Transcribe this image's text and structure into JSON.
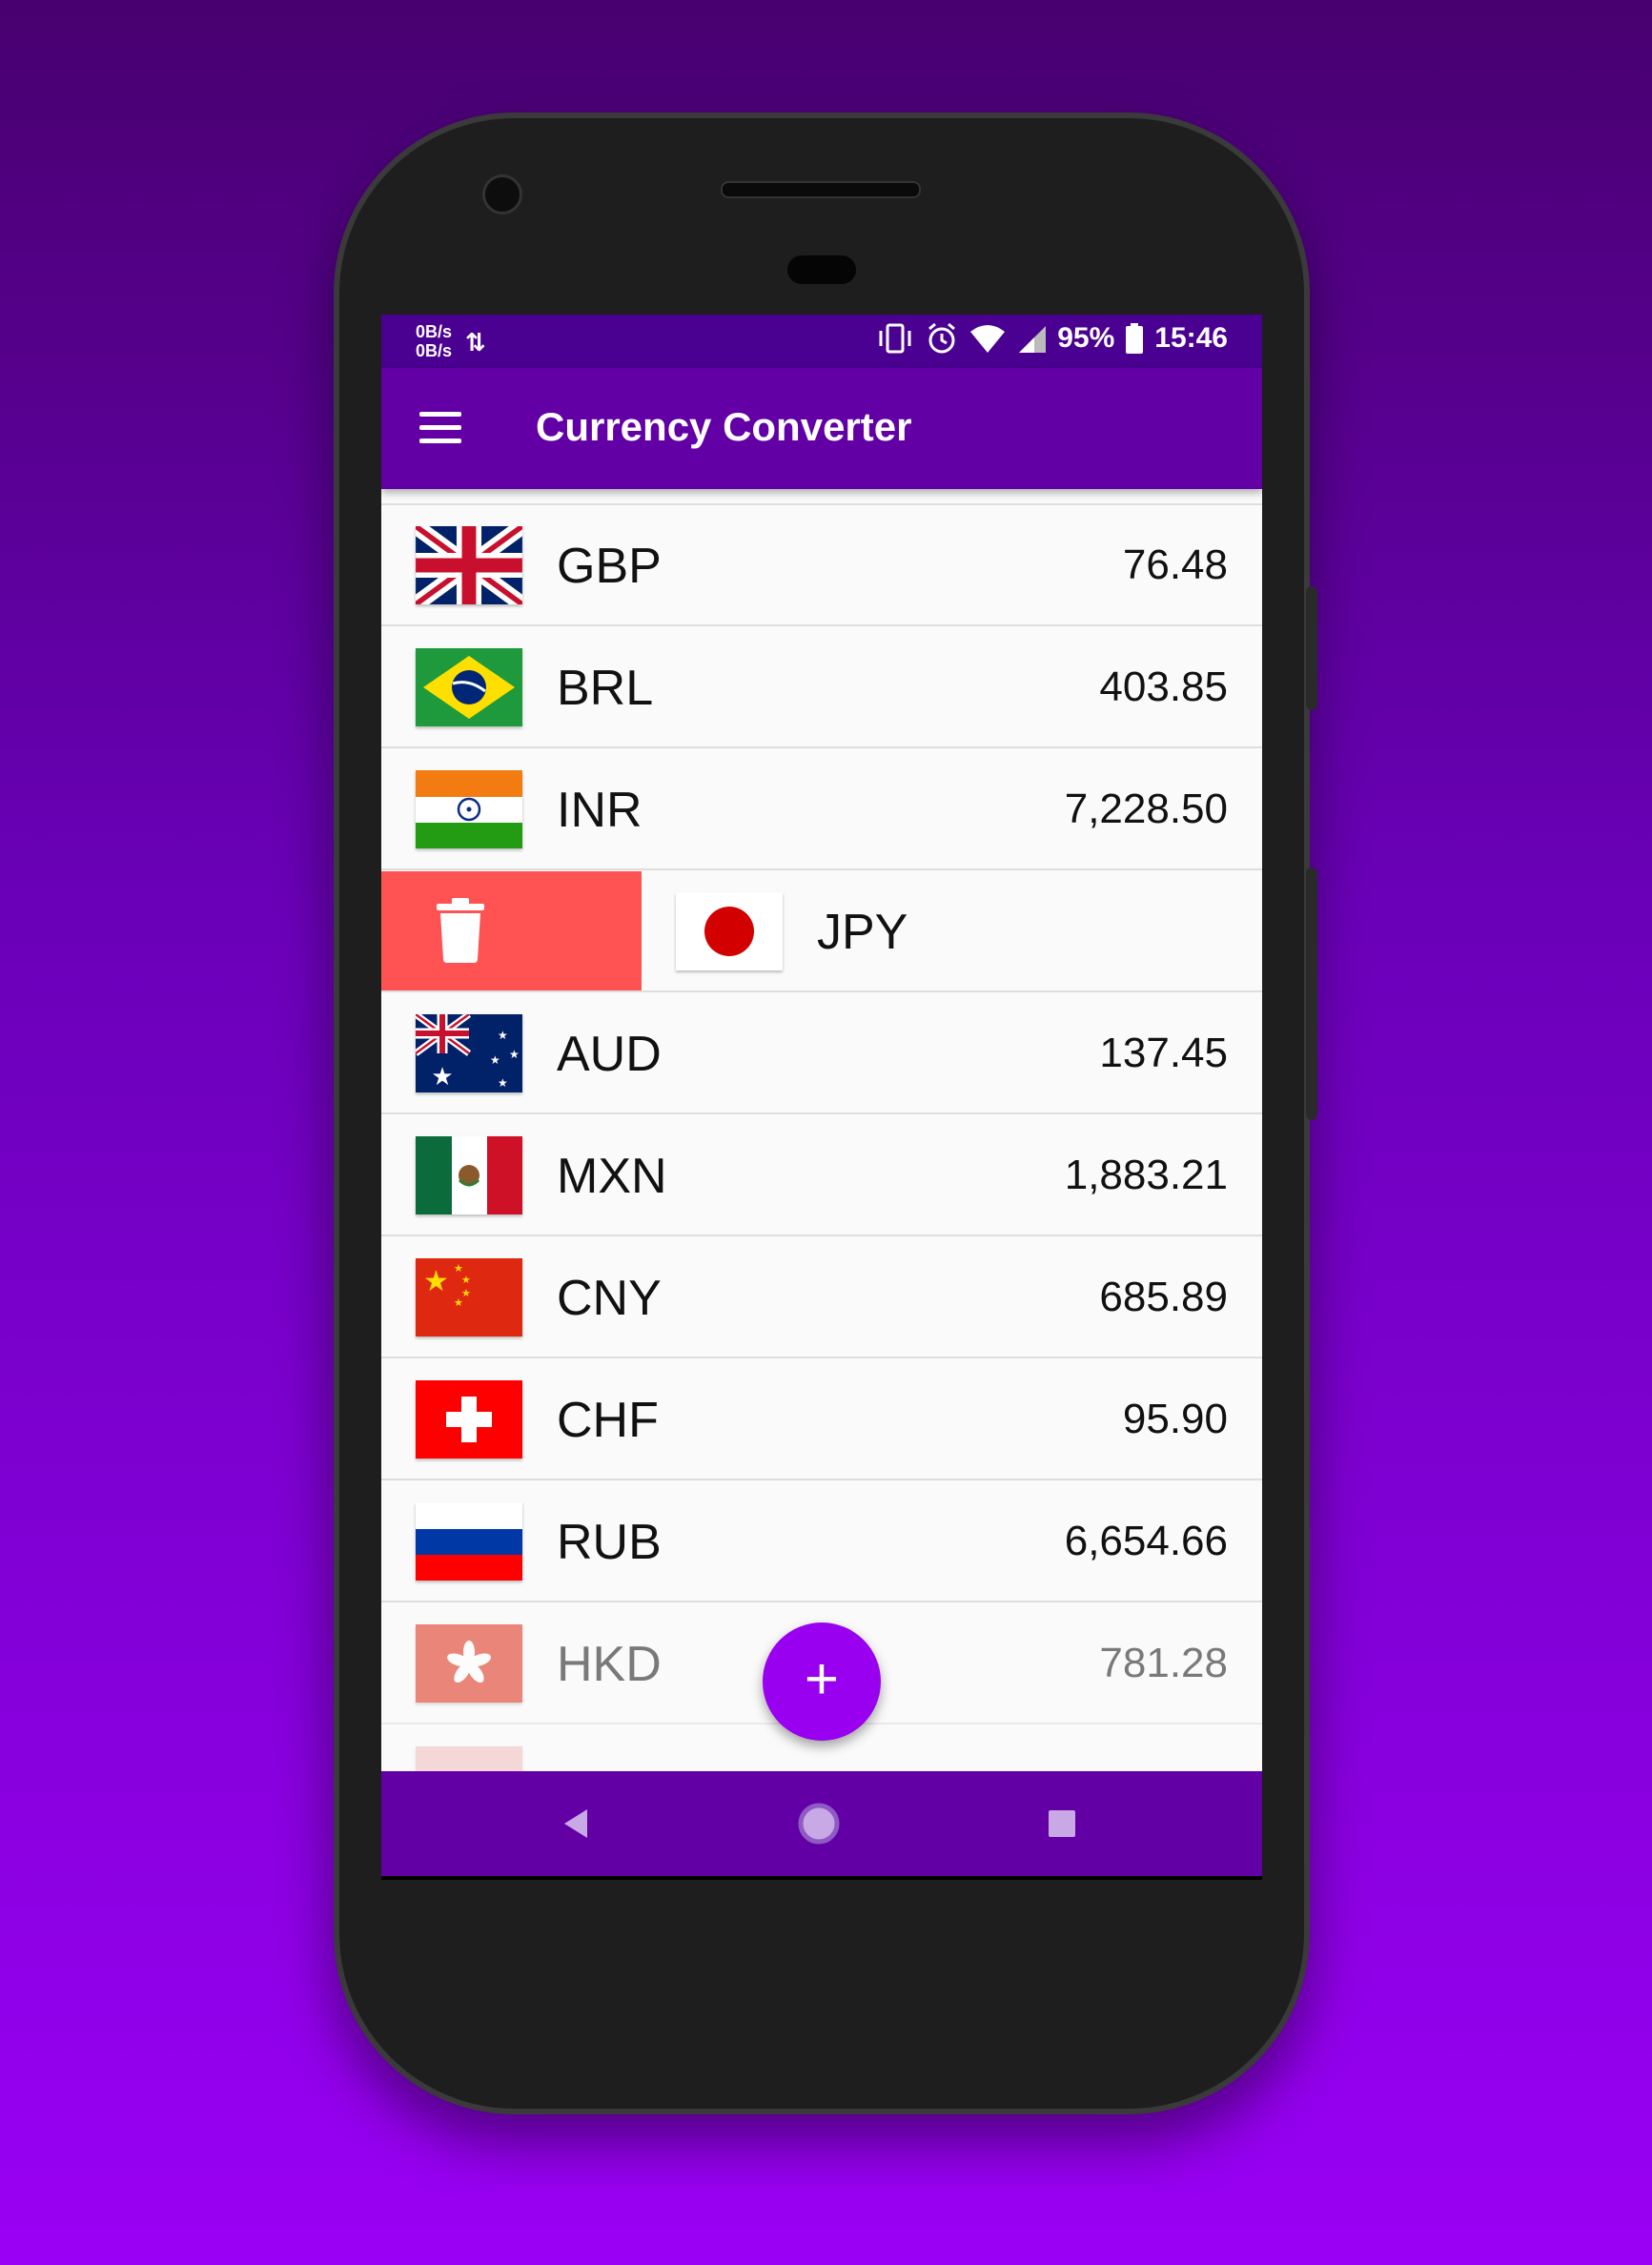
{
  "status_bar": {
    "net_up": "0B/s",
    "net_down": "0B/s",
    "battery": "95%",
    "time": "15:46"
  },
  "app_bar": {
    "title": "Currency Converter"
  },
  "currencies": [
    {
      "code": "GBP",
      "value": "76.48",
      "flag": "uk-flag"
    },
    {
      "code": "BRL",
      "value": "403.85",
      "flag": "brazil-flag"
    },
    {
      "code": "INR",
      "value": "7,228.50",
      "flag": "india-flag"
    },
    {
      "code": "JPY",
      "value": "",
      "flag": "japan-flag",
      "swiped": true
    },
    {
      "code": "AUD",
      "value": "137.45",
      "flag": "australia-flag"
    },
    {
      "code": "MXN",
      "value": "1,883.21",
      "flag": "mexico-flag"
    },
    {
      "code": "CNY",
      "value": "685.89",
      "flag": "china-flag"
    },
    {
      "code": "CHF",
      "value": "95.90",
      "flag": "switzerland-flag"
    },
    {
      "code": "RUB",
      "value": "6,654.66",
      "flag": "russia-flag"
    },
    {
      "code": "HKD",
      "value": "781.28",
      "flag": "hongkong-flag"
    }
  ],
  "fab": {
    "label": "+"
  },
  "colors": {
    "primary": "#6200a6",
    "status_bar": "#4a0091",
    "fab": "#9a00f0",
    "delete": "#ff5252"
  },
  "icons": [
    "menu-icon",
    "trash-icon",
    "back-icon",
    "home-icon",
    "recents-icon",
    "vibrate-icon",
    "alarm-icon",
    "wifi-icon",
    "signal-icon",
    "battery-icon"
  ]
}
